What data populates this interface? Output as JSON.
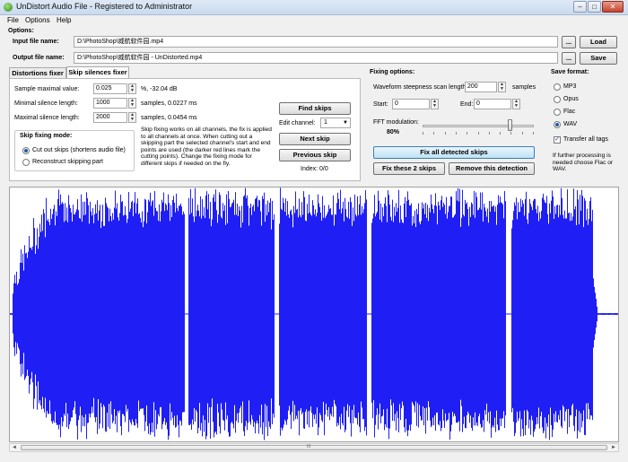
{
  "window": {
    "title": "UnDistort Audio File - Registered to Administrator",
    "minimize": "–",
    "maximize": "□",
    "close": "✕"
  },
  "menu": [
    "File",
    "Options",
    "Help"
  ],
  "options": {
    "heading": "Options:",
    "input_label": "Input file name:",
    "input_value": "D:\\PhotoShop\\威航软件园.mp4",
    "output_label": "Output file name:",
    "output_value": "D:\\PhotoShop\\威航软件园 - UnDistorted.mp4",
    "browse": "...",
    "load": "Load",
    "save": "Save"
  },
  "tabs": [
    "Distortions fixer",
    "Skip silences fixer"
  ],
  "skip_fixer": {
    "sample_max_label": "Sample maximal value:",
    "sample_max_value": "0.025",
    "sample_max_unit": "%, -32.04 dB",
    "min_len_label": "Minimal silence length:",
    "min_len_value": "1000",
    "min_len_unit": "samples, 0.0227 ms",
    "max_len_label": "Maximal silence length:",
    "max_len_value": "2000",
    "max_len_unit": "samples, 0.0454 ms",
    "mode_title": "Skip fixing mode:",
    "mode_cut": "Cut out skips (shortens audio file)",
    "mode_reconstruct": "Reconstruct skipping part",
    "description": "Skip fixing works on all channels, the fix is applied to all channels at once. When cutting out a skipping part the selected channel's start and end points are used (the darker red lines mark the cutting points). Change the fixing mode for different skips if needed on the fly.",
    "find_skips": "Find skips",
    "edit_channel_label": "Edit channel:",
    "edit_channel_value": "1",
    "next_skip": "Next skip",
    "previous_skip": "Previous skip",
    "index": "Index: 0/0"
  },
  "fixing": {
    "heading": "Fixing options:",
    "steepness_label": "Waveform steepness scan length:",
    "steepness_value": "200",
    "steepness_unit": "samples",
    "start_label": "Start:",
    "start_value": "0",
    "end_label": "End:",
    "end_value": "0",
    "fft_label": "FFT modulation:",
    "fft_value": "80%",
    "fft_fraction": 0.8,
    "fix_all": "Fix all detected skips",
    "fix_these": "Fix these 2 skips",
    "remove_detection": "Remove this detection"
  },
  "save_format": {
    "heading": "Save format:",
    "options": [
      "MP3",
      "Opus",
      "Flac",
      "WAV"
    ],
    "selected": "WAV",
    "transfer_tags": "Transfer all tags",
    "note": "If further processing is needed choose Flac or WAV."
  },
  "waveform": {
    "color": "#1f1ff5",
    "scroll_thumb": "III"
  }
}
